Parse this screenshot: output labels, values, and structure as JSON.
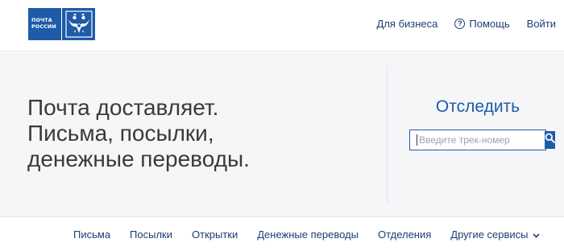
{
  "header": {
    "logo": {
      "line1": "ПОЧТА",
      "line2": "РОССИИ"
    },
    "nav": {
      "business": "Для бизнеса",
      "help": "Помощь",
      "login": "Войти",
      "help_icon_glyph": "?"
    }
  },
  "hero": {
    "tagline": [
      "Почта доставляет.",
      "Письма, посылки,",
      "денежные переводы."
    ]
  },
  "tracking": {
    "title": "Отследить",
    "input_placeholder": "Введите трек-номер",
    "input_value": "",
    "search_icon": "search-icon"
  },
  "bottom_nav": {
    "items": [
      "Письма",
      "Посылки",
      "Открытки",
      "Денежные переводы",
      "Отделения",
      "Другие сервисы"
    ]
  },
  "colors": {
    "brand_blue": "#1e5ba8",
    "link_blue": "#1a3f73",
    "hero_bg": "#f5f6f8"
  }
}
